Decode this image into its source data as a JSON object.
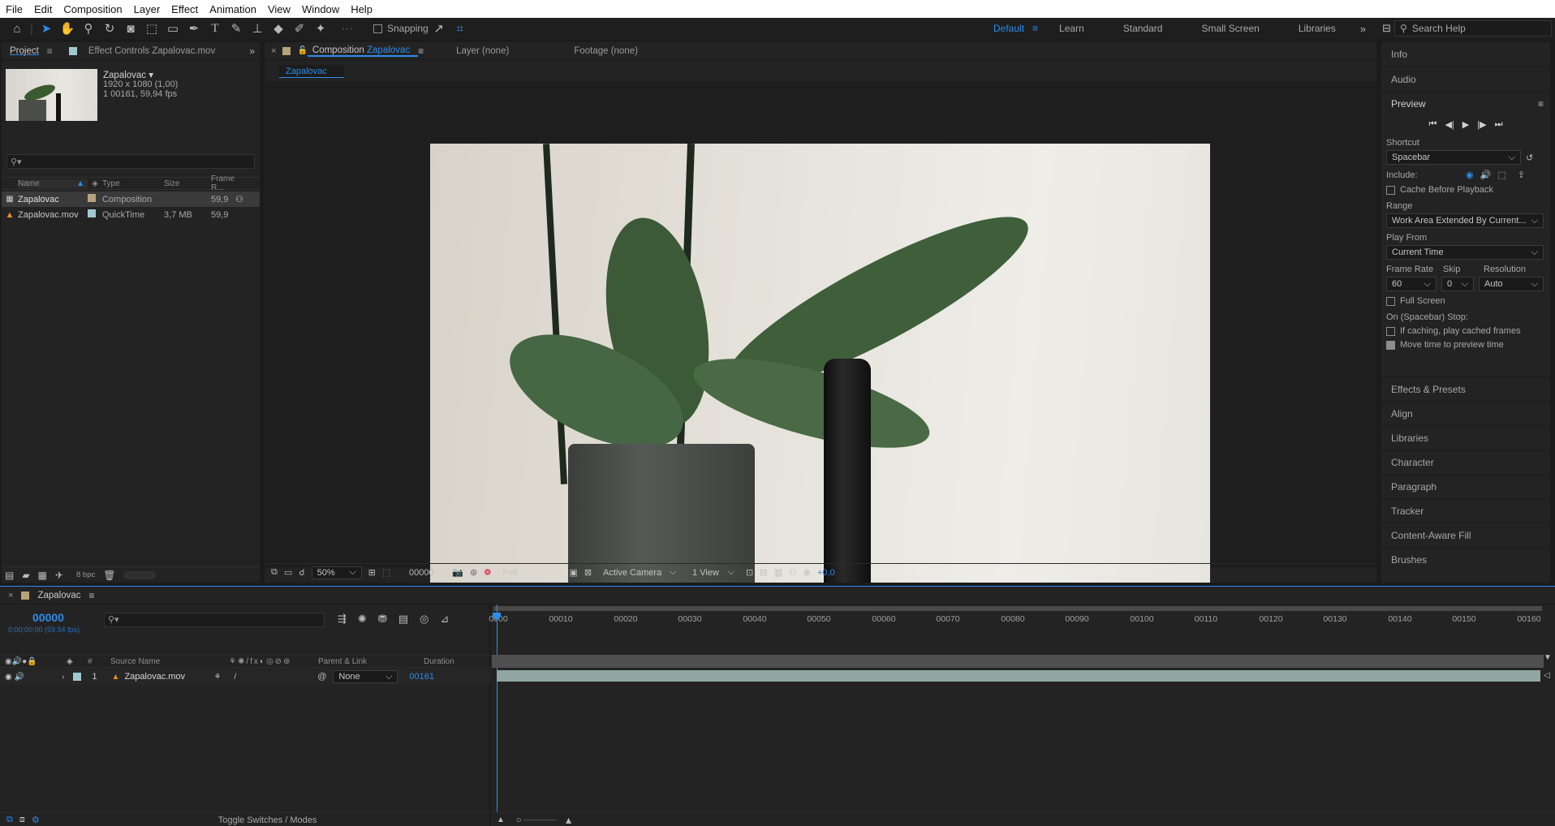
{
  "menu": [
    "File",
    "Edit",
    "Composition",
    "Layer",
    "Effect",
    "Animation",
    "View",
    "Window",
    "Help"
  ],
  "toolbar": {
    "snapping_label": "Snapping",
    "workspaces": [
      "Default",
      "Learn",
      "Standard",
      "Small Screen",
      "Libraries"
    ],
    "active_workspace": "Default",
    "search_placeholder": "Search Help"
  },
  "project": {
    "tab_project": "Project",
    "tab_effect_controls": "Effect Controls Zapalovac.mov",
    "item_name": "Zapalovac",
    "item_res": "1920 x 1080 (1,00)",
    "item_duration": "1 00161, 59,94 fps",
    "columns": [
      "Name",
      "Type",
      "Size",
      "Frame R..."
    ],
    "rows": [
      {
        "name": "Zapalovac",
        "type": "Composition",
        "size": "",
        "fps": "59,9",
        "color": "#b7a37a",
        "icon": "composition-icon"
      },
      {
        "name": "Zapalovac.mov",
        "type": "QuickTime",
        "size": "3,7 MB",
        "fps": "59,9",
        "color": "#9fc9d0",
        "icon": "vlc-cone-icon"
      }
    ],
    "bpc": "8 bpc"
  },
  "composition": {
    "tab_label": "Composition",
    "tab_name": "Zapalovac",
    "tab_layer": "Layer (none)",
    "tab_footage": "Footage (none)",
    "breadcrumb": "Zapalovac",
    "zoom": "50%",
    "timecode": "00000",
    "resolution": "Full",
    "camera": "Active Camera",
    "views": "1 View",
    "exposure": "+0,0"
  },
  "right_panel": {
    "info": "Info",
    "audio": "Audio",
    "preview": "Preview",
    "shortcut_label": "Shortcut",
    "shortcut_value": "Spacebar",
    "include_label": "Include:",
    "cache_label": "Cache Before Playback",
    "range_label": "Range",
    "range_value": "Work Area Extended By Current...",
    "play_from_label": "Play From",
    "play_from_value": "Current Time",
    "frame_rate_label": "Frame Rate",
    "skip_label": "Skip",
    "resolution_label": "Resolution",
    "frame_rate_value": "60",
    "skip_value": "0",
    "resolution_value": "Auto",
    "full_screen_label": "Full Screen",
    "stop_label": "On (Spacebar) Stop:",
    "if_caching_label": "If caching, play cached frames",
    "move_time_label": "Move time to preview time",
    "sections": [
      "Effects & Presets",
      "Align",
      "Libraries",
      "Character",
      "Paragraph",
      "Tracker",
      "Content-Aware Fill",
      "Brushes"
    ]
  },
  "timeline": {
    "tab_name": "Zapalovac",
    "timecode": "00000",
    "timecode_sub": "0;00;00;00 (59.94 fps)",
    "col_hash": "#",
    "col_source": "Source Name",
    "col_parent": "Parent & Link",
    "col_duration": "Duration",
    "layer_num": "1",
    "layer_name": "Zapalovac.mov",
    "layer_parent": "None",
    "layer_duration": "00161",
    "ruler_start": "0000",
    "ruler_ticks": [
      "00010",
      "00020",
      "00030",
      "00040",
      "00050",
      "00060",
      "00070",
      "00080",
      "00090",
      "00100",
      "00110",
      "00120",
      "00130",
      "00140",
      "00150",
      "00160"
    ],
    "toggle_label": "Toggle Switches / Modes"
  },
  "colors": {
    "accent": "#2d8ceb",
    "panel": "#232323",
    "track_bar": "#8fa7a0"
  }
}
